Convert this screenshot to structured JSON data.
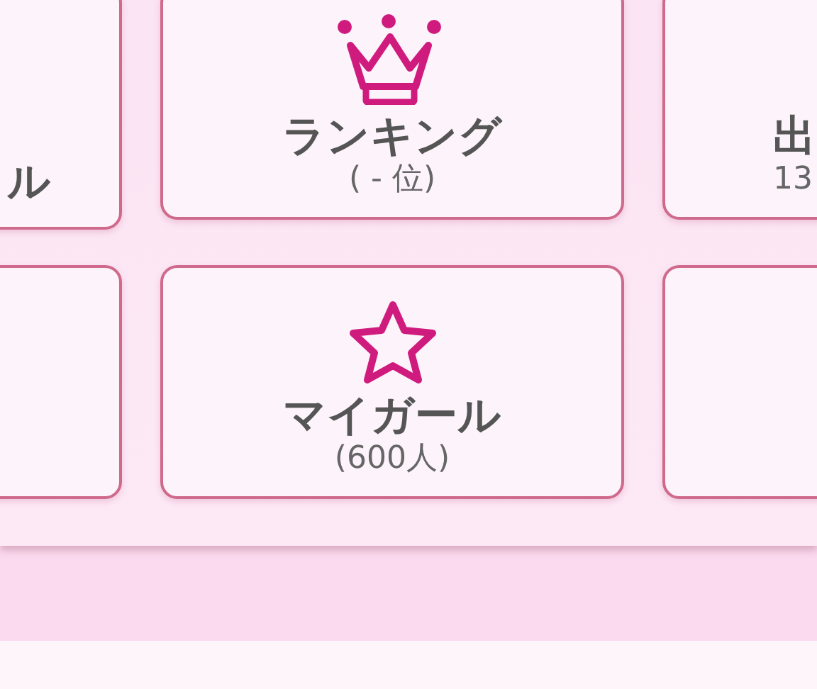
{
  "menu_rows": [
    {
      "cards": [
        {
          "kind": "plain",
          "label": "ル"
        },
        {
          "kind": "crown",
          "label": "ランキング",
          "detail": "( - 位)"
        },
        {
          "kind": "plain",
          "label": "出",
          "detail": "13"
        }
      ]
    },
    {
      "cards": [
        {
          "kind": "empty"
        },
        {
          "kind": "star",
          "label": "マイガール",
          "detail": "(600人)"
        },
        {
          "kind": "empty"
        }
      ]
    }
  ]
}
